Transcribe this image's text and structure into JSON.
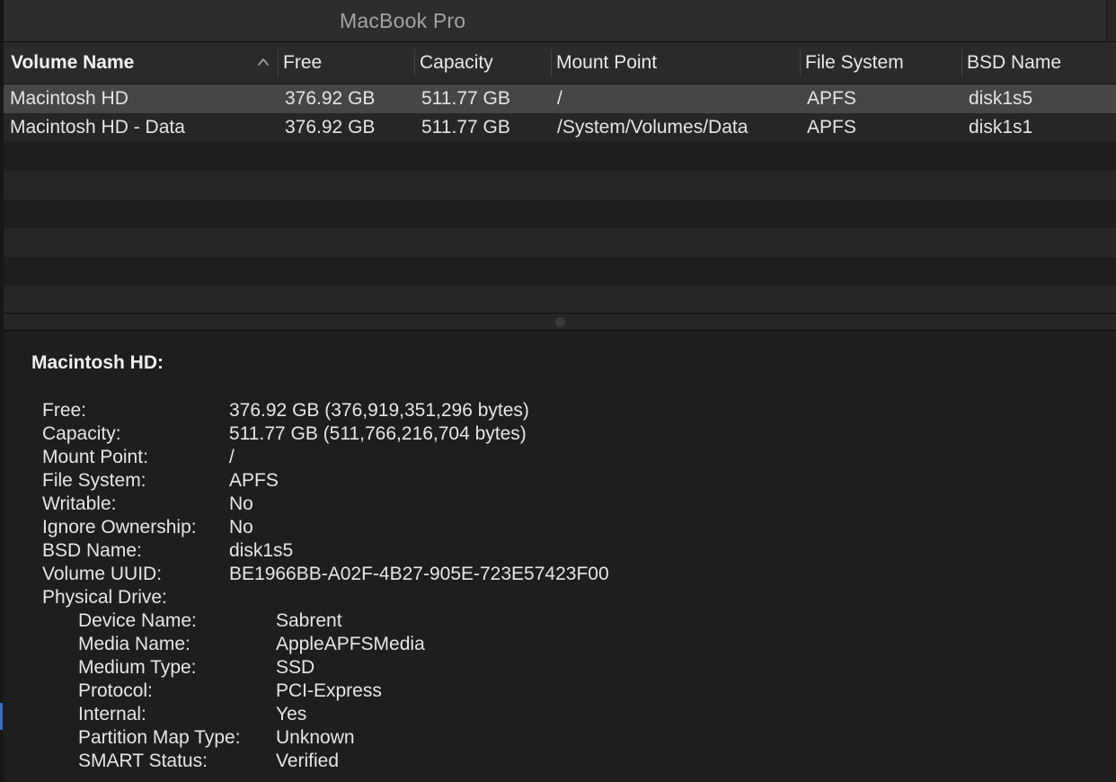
{
  "window": {
    "title": "MacBook Pro"
  },
  "table": {
    "columns": [
      {
        "label": "Volume Name",
        "sorted": true
      },
      {
        "label": "Free"
      },
      {
        "label": "Capacity"
      },
      {
        "label": "Mount Point"
      },
      {
        "label": "File System"
      },
      {
        "label": "BSD Name"
      }
    ],
    "rows": [
      {
        "volume_name": "Macintosh HD",
        "free": "376.92 GB",
        "capacity": "511.77 GB",
        "mount_point": "/",
        "file_system": "APFS",
        "bsd_name": "disk1s5",
        "selected": true
      },
      {
        "volume_name": "Macintosh HD - Data",
        "free": "376.92 GB",
        "capacity": "511.77 GB",
        "mount_point": "/System/Volumes/Data",
        "file_system": "APFS",
        "bsd_name": "disk1s1",
        "selected": false
      }
    ]
  },
  "details": {
    "title": "Macintosh HD:",
    "fields": [
      {
        "label": "Free:",
        "value": "376.92 GB (376,919,351,296 bytes)"
      },
      {
        "label": "Capacity:",
        "value": "511.77 GB (511,766,216,704 bytes)"
      },
      {
        "label": "Mount Point:",
        "value": "/"
      },
      {
        "label": "File System:",
        "value": "APFS"
      },
      {
        "label": "Writable:",
        "value": "No"
      },
      {
        "label": "Ignore Ownership:",
        "value": "No"
      },
      {
        "label": "BSD Name:",
        "value": "disk1s5"
      },
      {
        "label": "Volume UUID:",
        "value": "BE1966BB-A02F-4B27-905E-723E57423F00"
      },
      {
        "label": "Physical Drive:",
        "value": ""
      }
    ],
    "physical_drive": [
      {
        "label": "Device Name:",
        "value": "Sabrent"
      },
      {
        "label": "Media Name:",
        "value": "AppleAPFSMedia"
      },
      {
        "label": "Medium Type:",
        "value": "SSD"
      },
      {
        "label": "Protocol:",
        "value": "PCI-Express"
      },
      {
        "label": "Internal:",
        "value": "Yes"
      },
      {
        "label": "Partition Map Type:",
        "value": "Unknown"
      },
      {
        "label": "SMART Status:",
        "value": "Verified"
      }
    ]
  },
  "icons": {
    "sort": "chevron-up-icon"
  },
  "colors": {
    "background": "#1e1e1e",
    "selected_row": "#464646",
    "header": "#2a2a2a",
    "text": "#e6e6e6"
  }
}
